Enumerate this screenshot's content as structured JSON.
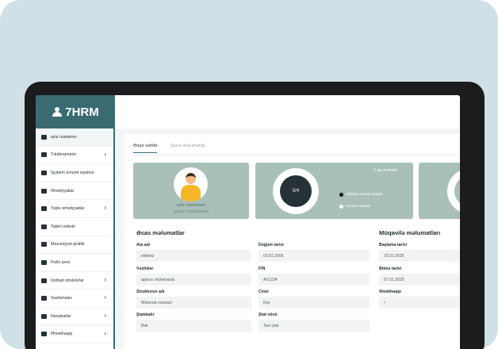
{
  "app": {
    "logo_text": "7HRM"
  },
  "sidebar": {
    "items": [
      {
        "label": "aziz rustamov",
        "chevron": false
      },
      {
        "label": "Tələbnamələr",
        "chevron": true
      },
      {
        "label": "İşçilərin ümumi siyahısı",
        "chevron": false
      },
      {
        "label": "Əməliyyatlar",
        "chevron": false
      },
      {
        "label": "Toplu əməliyyatlar",
        "chevron": true
      },
      {
        "label": "Tabel cədvəli",
        "chevron": false
      },
      {
        "label": "Məzuniyyət qrafiki",
        "chevron": false
      },
      {
        "label": "Fiziki şəxs",
        "chevron": false
      },
      {
        "label": "İnzibati strukturlar",
        "chevron": true
      },
      {
        "label": "Sazlamalar",
        "chevron": true
      },
      {
        "label": "Hesabatlar",
        "chevron": true
      },
      {
        "label": "Əməkhaqqı",
        "chevron": true
      }
    ]
  },
  "tabs": [
    {
      "label": "Əsas səhifə"
    },
    {
      "label": "Şəxsi məlumatlar"
    }
  ],
  "profile": {
    "name": "aziz rustamov",
    "role": "aparıcı mütəxəssis"
  },
  "stats": {
    "ring_value": "0/4",
    "period": "1 ay ərzində",
    "legend_used": "İstifadə olunan saatlar",
    "legend_total": "Ümumi saatlar",
    "legend_used_color": "#111111",
    "legend_total_color": "#ffffff"
  },
  "main_info": {
    "title": "Əsas məlumatlar",
    "fields": [
      {
        "label": "Ata adı",
        "value": "eldeniz"
      },
      {
        "label": "Vəzifələr",
        "value": "aparıcı mütəxəssis"
      },
      {
        "label": "Strukturun adı",
        "value": "Məlumat markazi"
      },
      {
        "label": "Ştatdadır",
        "value": "Bəli"
      },
      {
        "label": "Doğum tarixi",
        "value": "03.01.2006"
      },
      {
        "label": "FİN",
        "value": "AV1234"
      },
      {
        "label": "Cinsi",
        "value": "Kişi"
      },
      {
        "label": "Ştat növü",
        "value": "Tam ştat"
      }
    ]
  },
  "contract_info": {
    "title": "Müqavilə məlumatları",
    "fields": [
      {
        "label": "Başlama tarixi",
        "value": "15.01.2025"
      },
      {
        "label": "Bitmə tarixi",
        "value": "07.01.2025"
      },
      {
        "label": "Əməkhaqqı",
        "value": "•"
      }
    ]
  },
  "colors": {
    "accent": "#3a6b73",
    "panel": "#a8c0b8",
    "frame": "#1c1c1e",
    "background": "#cfe0e6"
  }
}
